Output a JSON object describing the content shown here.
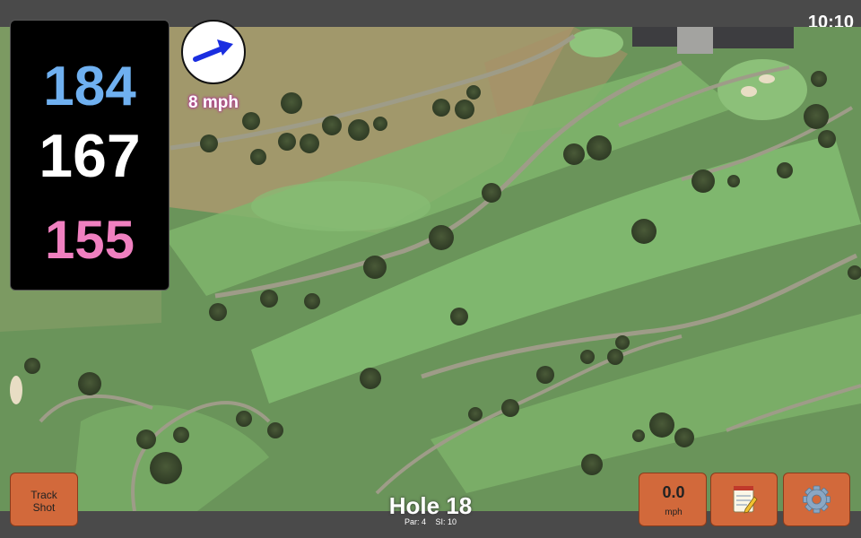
{
  "status": {
    "clock": "10:10"
  },
  "distances": {
    "back": "184",
    "middle": "167",
    "front": "155"
  },
  "wind": {
    "speed_label": "8 mph",
    "icon": "wind-direction-arrow-icon"
  },
  "hole": {
    "title": "Hole 18",
    "par_label": "Par: 4",
    "si_label": "SI: 10"
  },
  "buttons": {
    "track_shot_line1": "Track",
    "track_shot_line2": "Shot",
    "speed_value": "0.0",
    "speed_unit": "mph",
    "notes_icon": "notepad-icon",
    "settings_icon": "gear-icon"
  },
  "colors": {
    "back_distance": "#6fb0f0",
    "middle_distance": "#ffffff",
    "front_distance": "#f080c0",
    "button": "#d2693b"
  }
}
